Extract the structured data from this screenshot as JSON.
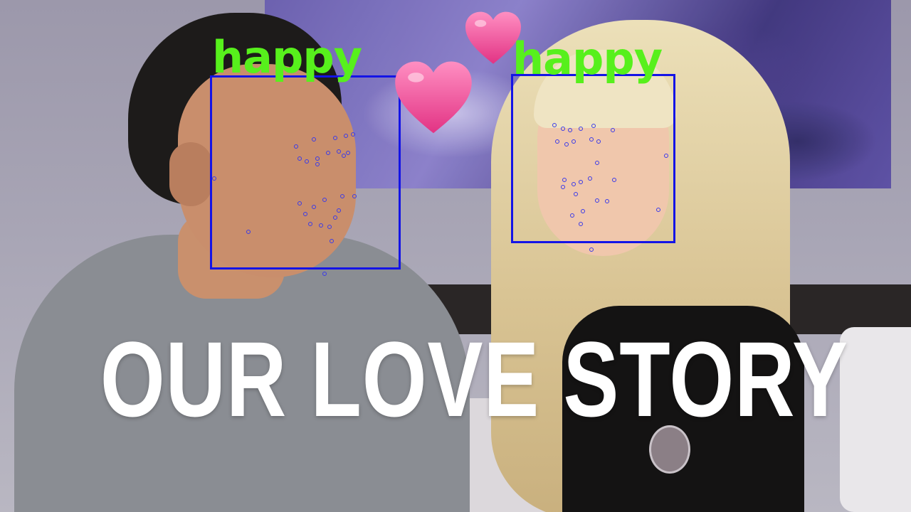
{
  "emotions": {
    "left_face": "happy",
    "right_face": "happy"
  },
  "title": "OUR LOVE STORY",
  "colors": {
    "face_box": "#1414e6",
    "label": "#57f01c",
    "heart": "#f0509a",
    "title": "#ffffff"
  },
  "icons": [
    "heart-emoji",
    "heart-emoji"
  ]
}
